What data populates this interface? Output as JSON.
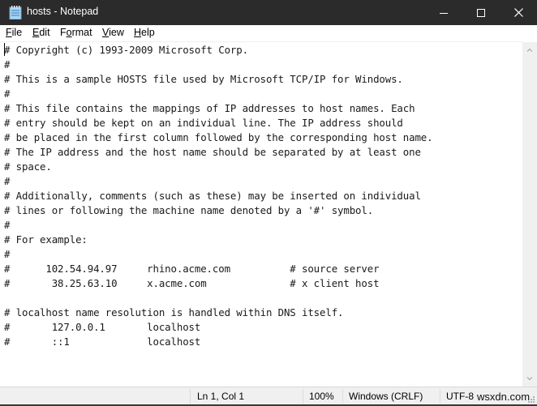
{
  "window": {
    "title": "hosts - Notepad",
    "controls": {
      "minimize": "minimize-icon",
      "maximize": "maximize-icon",
      "close": "close-icon"
    }
  },
  "menu": [
    {
      "label": "File",
      "mnemonic": "F",
      "rest": "ile"
    },
    {
      "label": "Edit",
      "mnemonic": "E",
      "rest": "dit"
    },
    {
      "label": "Format",
      "pre": "F",
      "mnemonic": "o",
      "rest": "rmat"
    },
    {
      "label": "View",
      "mnemonic": "V",
      "rest": "iew"
    },
    {
      "label": "Help",
      "mnemonic": "H",
      "rest": "elp"
    }
  ],
  "editor": {
    "content": "# Copyright (c) 1993-2009 Microsoft Corp.\n#\n# This is a sample HOSTS file used by Microsoft TCP/IP for Windows.\n#\n# This file contains the mappings of IP addresses to host names. Each\n# entry should be kept on an individual line. The IP address should\n# be placed in the first column followed by the corresponding host name.\n# The IP address and the host name should be separated by at least one\n# space.\n#\n# Additionally, comments (such as these) may be inserted on individual\n# lines or following the machine name denoted by a '#' symbol.\n#\n# For example:\n#\n#      102.54.94.97     rhino.acme.com          # source server\n#       38.25.63.10     x.acme.com              # x client host\n\n# localhost name resolution is handled within DNS itself.\n#\t127.0.0.1       localhost\n#\t::1             localhost"
  },
  "status": {
    "position": "Ln 1, Col 1",
    "zoom": "100%",
    "line_ending": "Windows (CRLF)",
    "encoding": "UTF-8",
    "watermark": "wsxdn.com"
  }
}
